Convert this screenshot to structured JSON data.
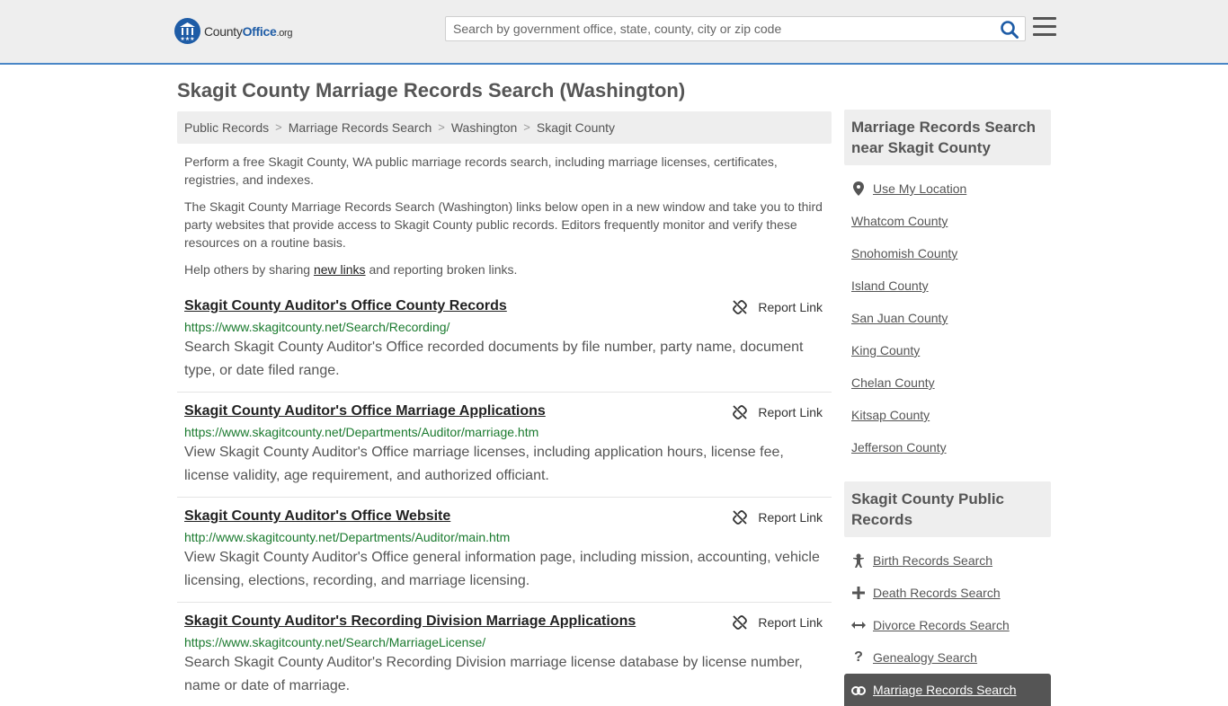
{
  "header": {
    "logo_county": "County",
    "logo_office": "Office",
    "logo_org": ".org",
    "search_placeholder": "Search by government office, state, county, city or zip code"
  },
  "page_title": "Skagit County Marriage Records Search (Washington)",
  "breadcrumbs": [
    "Public Records",
    "Marriage Records Search",
    "Washington",
    "Skagit County"
  ],
  "intro": {
    "p1": "Perform a free Skagit County, WA public marriage records search, including marriage licenses, certificates, registries, and indexes.",
    "p2": "The Skagit County Marriage Records Search (Washington) links below open in a new window and take you to third party websites that provide access to Skagit County public records. Editors frequently monitor and verify these resources on a routine basis.",
    "p3_before": "Help others by sharing ",
    "p3_link": "new links",
    "p3_after": " and reporting broken links."
  },
  "report_label": "Report Link",
  "results": [
    {
      "title": "Skagit County Auditor's Office County Records",
      "url": "https://www.skagitcounty.net/Search/Recording/",
      "desc": "Search Skagit County Auditor's Office recorded documents by file number, party name, document type, or date filed range."
    },
    {
      "title": "Skagit County Auditor's Office Marriage Applications",
      "url": "https://www.skagitcounty.net/Departments/Auditor/marriage.htm",
      "desc": "View Skagit County Auditor's Office marriage licenses, including application hours, license fee, license validity, age requirement, and authorized officiant."
    },
    {
      "title": "Skagit County Auditor's Office Website",
      "url": "http://www.skagitcounty.net/Departments/Auditor/main.htm",
      "desc": "View Skagit County Auditor's Office general information page, including mission, accounting, vehicle licensing, elections, recording, and marriage licensing."
    },
    {
      "title": "Skagit County Auditor's Recording Division Marriage Applications",
      "url": "https://www.skagitcounty.net/Search/MarriageLicense/",
      "desc": "Search Skagit County Auditor's Recording Division marriage license database by license number, name or date of marriage."
    }
  ],
  "sidebar": {
    "nearby_title": "Marriage Records Search near Skagit County",
    "use_location": "Use My Location",
    "nearby": [
      "Whatcom County",
      "Snohomish County",
      "Island County",
      "San Juan County",
      "King County",
      "Chelan County",
      "Kitsap County",
      "Jefferson County"
    ],
    "public_title": "Skagit County Public Records",
    "public": [
      {
        "label": "Birth Records Search",
        "icon": "baby-icon"
      },
      {
        "label": "Death Records Search",
        "icon": "cross-icon"
      },
      {
        "label": "Divorce Records Search",
        "icon": "arrows-icon"
      },
      {
        "label": "Genealogy Search",
        "icon": "question-icon"
      },
      {
        "label": "Marriage Records Search",
        "icon": "rings-icon"
      }
    ]
  }
}
